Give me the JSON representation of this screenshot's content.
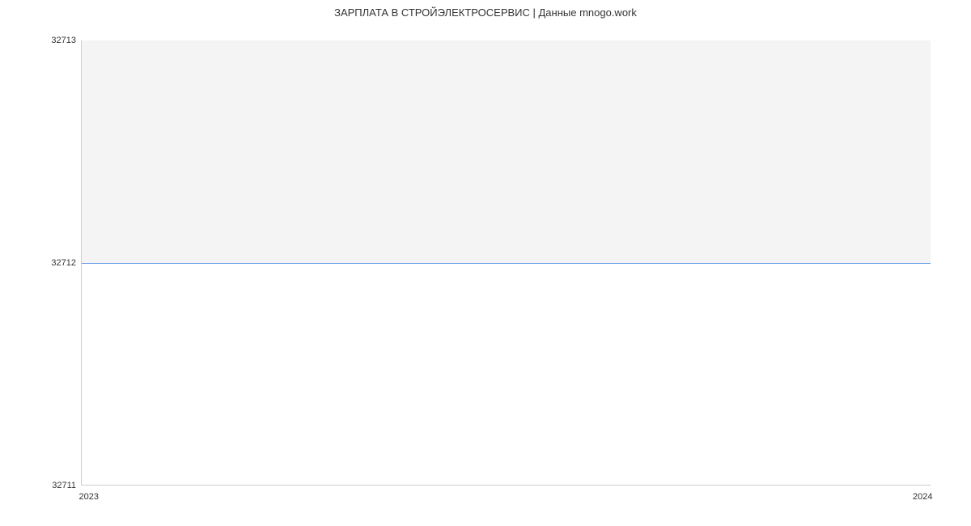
{
  "chart_data": {
    "type": "area",
    "title": "ЗАРПЛАТА В СТРОЙЭЛЕКТРОСЕРВИС | Данные mnogo.work",
    "xlabel": "",
    "ylabel": "",
    "x": [
      "2023",
      "2024"
    ],
    "values": [
      32712,
      32712
    ],
    "ylim": [
      32711,
      32713
    ],
    "y_ticks": [
      32711,
      32712,
      32713
    ],
    "colors": {
      "line": "#6d9eeb",
      "fill": "#f4f4f4"
    }
  }
}
